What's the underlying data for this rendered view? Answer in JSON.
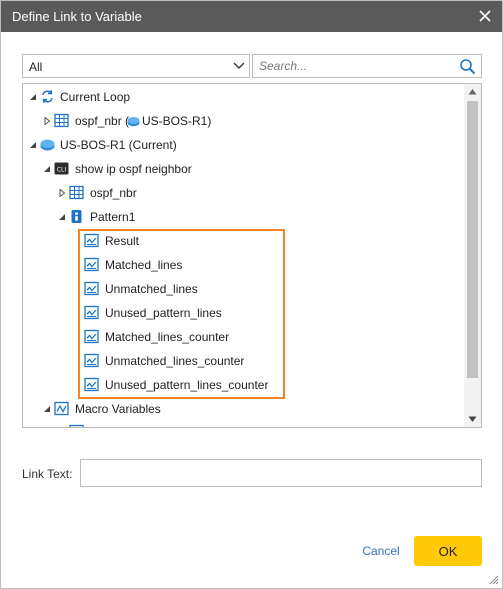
{
  "dialog": {
    "title": "Define Link to Variable"
  },
  "filter": {
    "selected": "All"
  },
  "search": {
    "placeholder": "Search..."
  },
  "tree": {
    "current_loop": "Current Loop",
    "loop_table": "ospf_nbr (",
    "loop_device": "US-BOS-R1)",
    "device": "US-BOS-R1 (Current)",
    "command": "show ip ospf neighbor",
    "table": "ospf_nbr",
    "pattern": "Pattern1",
    "pattern_vars": [
      "Result",
      "Matched_lines",
      "Unmatched_lines",
      "Unused_pattern_lines",
      "Matched_lines_counter",
      "Unmatched_lines_counter",
      "Unused_pattern_lines_counter"
    ],
    "macro": "Macro Variables"
  },
  "link_text": {
    "label": "Link Text:",
    "value": ""
  },
  "buttons": {
    "cancel": "Cancel",
    "ok": "OK"
  },
  "colors": {
    "titlebar": "#5a5a5a",
    "accent_highlight": "#f5832a",
    "ok_button": "#ffc907",
    "link": "#2b73b9",
    "icon_blue": "#1e73c8"
  },
  "icons": {
    "loop": "loop-icon",
    "table": "table-icon",
    "device": "router-icon",
    "cli": "cli-icon",
    "pattern": "pattern-icon",
    "variable": "variable-icon",
    "macro": "macro-icon"
  }
}
